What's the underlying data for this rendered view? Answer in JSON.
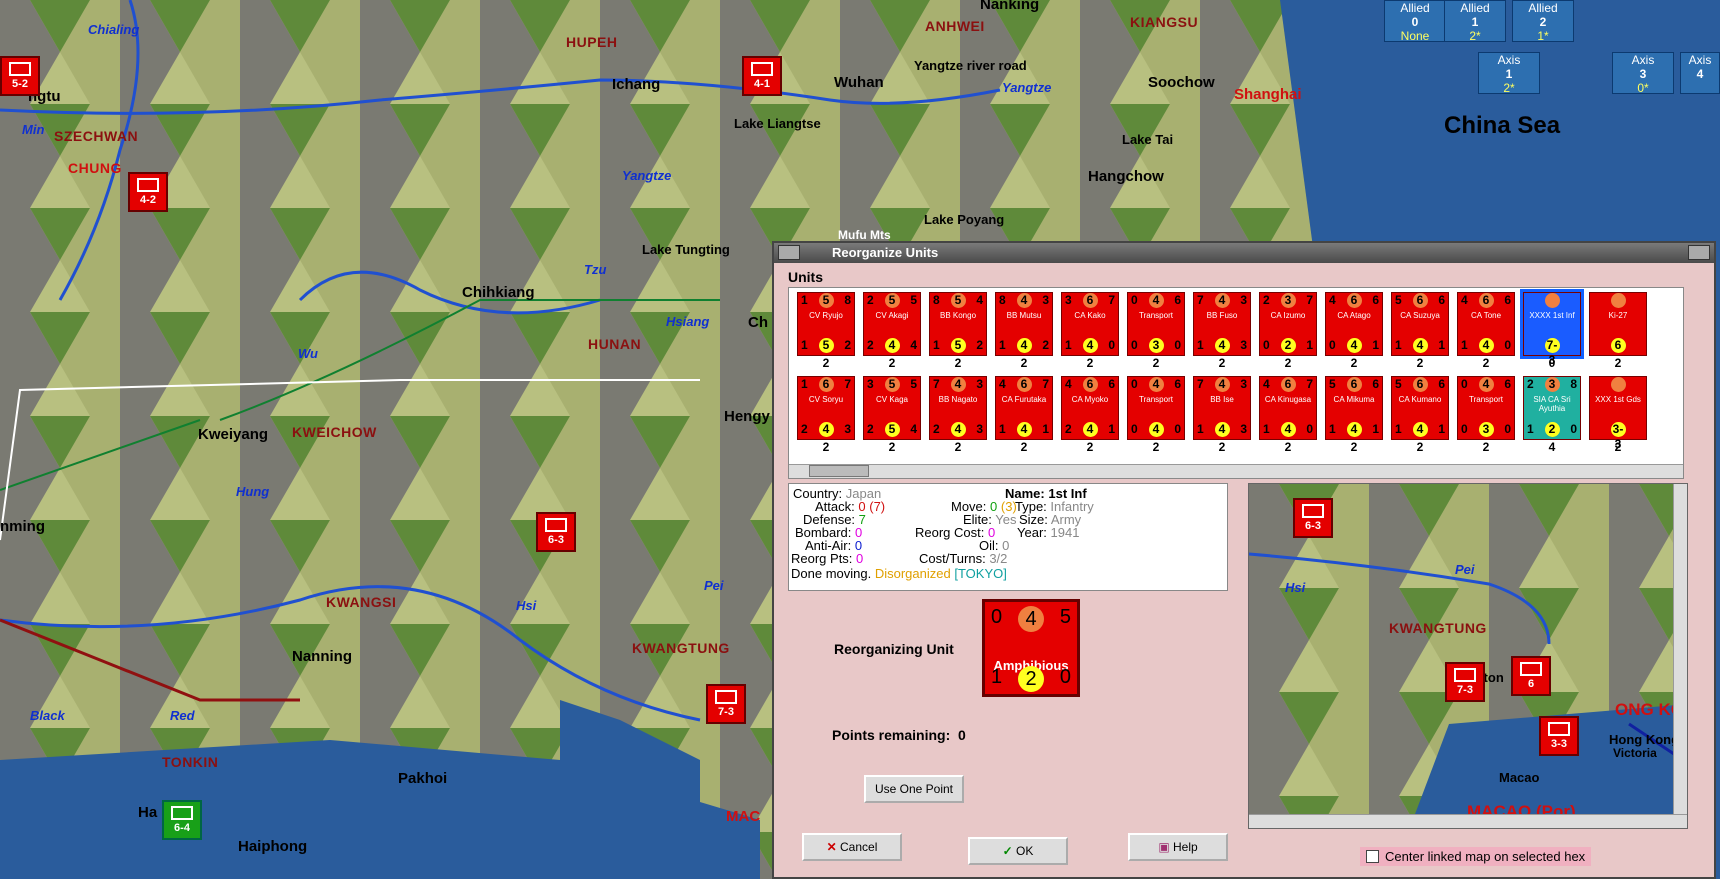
{
  "map": {
    "cities": [
      {
        "name": "Nanking"
      },
      {
        "name": "Ichang"
      },
      {
        "name": "Wuhan"
      },
      {
        "name": "Soochow"
      },
      {
        "name": "Shanghai"
      },
      {
        "name": "Hangchow"
      },
      {
        "name": "Chihkiang"
      },
      {
        "name": "Kweiyang"
      },
      {
        "name": "Hengy"
      },
      {
        "name": "Nanning"
      },
      {
        "name": "Pakhoi"
      },
      {
        "name": "Haiphong"
      },
      {
        "name": "Macao"
      },
      {
        "name": "Kanton"
      },
      {
        "name": "ngtu"
      },
      {
        "name": "Ch"
      },
      {
        "name": "nming"
      },
      {
        "name": "Ha"
      }
    ],
    "provinces": [
      "HUPEH",
      "ANHWEI",
      "KIANGSU",
      "SZECHWAN",
      "HUNAN",
      "KWEICHOW",
      "KWANGSI",
      "KWANGTUNG",
      "TONKIN",
      "CHUNG"
    ],
    "rivers": [
      "Chialing",
      "Min",
      "Yangtze",
      "Yangtze",
      "Tzu",
      "Hsiang",
      "Wu",
      "Hung",
      "Hsi",
      "Pei",
      "Black",
      "Red"
    ],
    "features": [
      "Yangtze river road",
      "Lake Liangtse",
      "Lake Tai",
      "Lake Poyang",
      "Lake Tungting",
      "Mufu Mts"
    ],
    "sea_label": "China Sea",
    "counters": [
      {
        "value": "5-2"
      },
      {
        "value": "4-2"
      },
      {
        "value": "4-1"
      },
      {
        "value": "6-3"
      },
      {
        "value": "7-3"
      },
      {
        "value": "6-4"
      }
    ]
  },
  "status_boxes": [
    {
      "side": "Allied",
      "num": "0",
      "sub": "None"
    },
    {
      "side": "Allied",
      "num": "1",
      "sub": "2*"
    },
    {
      "side": "Allied",
      "num": "2",
      "sub": "1*"
    },
    {
      "side": "Axis",
      "num": "1",
      "sub": "2*"
    },
    {
      "side": "Axis",
      "num": "3",
      "sub": "0*"
    },
    {
      "side": "Axis",
      "num": "4",
      "sub": ""
    }
  ],
  "dialog": {
    "title": "Reorganize Units",
    "units_label": "Units",
    "units_row1": [
      {
        "a": "1",
        "b": "5",
        "c": "8",
        "name": "CV Ryujo",
        "d": "1",
        "e": "5",
        "f": "2",
        "count": "2"
      },
      {
        "a": "2",
        "b": "5",
        "c": "5",
        "name": "CV Akagi",
        "d": "2",
        "e": "4",
        "f": "4",
        "count": "2"
      },
      {
        "a": "8",
        "b": "5",
        "c": "4",
        "name": "BB Kongo",
        "d": "1",
        "e": "5",
        "f": "2",
        "count": "2"
      },
      {
        "a": "8",
        "b": "4",
        "c": "3",
        "name": "BB Mutsu",
        "d": "1",
        "e": "4",
        "f": "2",
        "count": "2"
      },
      {
        "a": "3",
        "b": "6",
        "c": "7",
        "name": "CA Kako",
        "d": "1",
        "e": "4",
        "f": "0",
        "count": "2"
      },
      {
        "a": "0",
        "b": "4",
        "c": "6",
        "name": "Transport",
        "d": "0",
        "e": "3",
        "f": "0",
        "count": "2"
      },
      {
        "a": "7",
        "b": "4",
        "c": "3",
        "name": "BB Fuso",
        "d": "1",
        "e": "4",
        "f": "3",
        "count": "2"
      },
      {
        "a": "2",
        "b": "3",
        "c": "7",
        "name": "CA Izumo",
        "d": "0",
        "e": "2",
        "f": "1",
        "count": "2"
      },
      {
        "a": "4",
        "b": "6",
        "c": "6",
        "name": "CA Atago",
        "d": "0",
        "e": "4",
        "f": "1",
        "count": "2"
      },
      {
        "a": "5",
        "b": "6",
        "c": "6",
        "name": "CA Suzuya",
        "d": "1",
        "e": "4",
        "f": "1",
        "count": "2"
      },
      {
        "a": "4",
        "b": "6",
        "c": "6",
        "name": "CA Tone",
        "d": "1",
        "e": "4",
        "f": "0",
        "count": "2"
      },
      {
        "a": "",
        "b": "",
        "c": "",
        "name": "XXXX 1st Inf",
        "d": "",
        "e": "7-3",
        "f": "",
        "count": "0"
      },
      {
        "a": "",
        "b": "",
        "c": "",
        "name": "Ki-27",
        "d": "",
        "e": "6",
        "f": "",
        "count": "2"
      }
    ],
    "units_row2": [
      {
        "a": "1",
        "b": "6",
        "c": "7",
        "name": "CV Soryu",
        "d": "2",
        "e": "4",
        "f": "3",
        "count": "2"
      },
      {
        "a": "3",
        "b": "5",
        "c": "5",
        "name": "CV Kaga",
        "d": "2",
        "e": "5",
        "f": "4",
        "count": "2"
      },
      {
        "a": "7",
        "b": "4",
        "c": "3",
        "name": "BB Nagato",
        "d": "2",
        "e": "4",
        "f": "3",
        "count": "2"
      },
      {
        "a": "4",
        "b": "6",
        "c": "7",
        "name": "CA Furutaka",
        "d": "1",
        "e": "4",
        "f": "1",
        "count": "2"
      },
      {
        "a": "4",
        "b": "6",
        "c": "6",
        "name": "CA Myoko",
        "d": "2",
        "e": "4",
        "f": "1",
        "count": "2"
      },
      {
        "a": "0",
        "b": "4",
        "c": "6",
        "name": "Transport",
        "d": "0",
        "e": "4",
        "f": "0",
        "count": "2"
      },
      {
        "a": "7",
        "b": "4",
        "c": "3",
        "name": "BB Ise",
        "d": "1",
        "e": "4",
        "f": "3",
        "count": "2"
      },
      {
        "a": "4",
        "b": "6",
        "c": "7",
        "name": "CA Kinugasa",
        "d": "1",
        "e": "4",
        "f": "0",
        "count": "2"
      },
      {
        "a": "5",
        "b": "6",
        "c": "6",
        "name": "CA Mikuma",
        "d": "1",
        "e": "4",
        "f": "1",
        "count": "2"
      },
      {
        "a": "5",
        "b": "6",
        "c": "6",
        "name": "CA Kumano",
        "d": "1",
        "e": "4",
        "f": "1",
        "count": "2"
      },
      {
        "a": "0",
        "b": "4",
        "c": "6",
        "name": "Transport",
        "d": "0",
        "e": "3",
        "f": "0",
        "count": "2"
      },
      {
        "a": "2",
        "b": "3",
        "c": "8",
        "name": "SIA CA Sri Ayuthia",
        "d": "1",
        "e": "2",
        "f": "0",
        "count": "4"
      },
      {
        "a": "",
        "b": "",
        "c": "",
        "name": "XXX 1st Gds",
        "d": "",
        "e": "3-3",
        "f": "",
        "count": "2"
      }
    ],
    "info": {
      "country_label": "Country:",
      "country": "Japan",
      "attack_label": "Attack:",
      "attack": "0",
      "attack_paren": "(7)",
      "defense_label": "Defense:",
      "defense": "7",
      "bombard_label": "Bombard:",
      "bombard": "0",
      "antiair_label": "Anti-Air:",
      "antiair": "0",
      "reorgpts_label": "Reorg Pts:",
      "reorgpts": "0",
      "done_moving": "Done moving.",
      "disorganized": "Disorganized",
      "tokyo": "[TOKYO]",
      "move_label": "Move:",
      "move": "0",
      "move_paren": "(3)",
      "elite_label": "Elite:",
      "elite": "Yes",
      "reorgcost_label": "Reorg Cost:",
      "reorgcost": "0",
      "oil_label": "Oil:",
      "oil": "0",
      "costturns_label": "Cost/Turns:",
      "costturns": "3/2",
      "name_label": "Name:",
      "name": "1st Inf",
      "type_label": "Type:",
      "type": "Infantry",
      "size_label": "Size:",
      "size": "Army",
      "year_label": "Year:",
      "year": "1941"
    },
    "reorganizing_label": "Reorganizing Unit",
    "reorg_unit": {
      "a": "0",
      "b": "4",
      "c": "5",
      "name": "Amphibious",
      "d": "1",
      "e": "2",
      "f": "0"
    },
    "points_remaining_label": "Points remaining:",
    "points_remaining": "0",
    "use_one_point": "Use One Point",
    "cancel": "Cancel",
    "ok": "OK",
    "help": "Help",
    "center_linked": "Center linked map on selected hex",
    "linked_map": {
      "labels": [
        "Hsi",
        "Pei",
        "KWANGTUNG",
        "Kanton",
        "Hong Kong",
        "Victoria",
        "Macao",
        "MACAO (Por)",
        "ONG KO"
      ],
      "counters": [
        "6-3",
        "7-3",
        "6",
        "3-3"
      ]
    }
  }
}
